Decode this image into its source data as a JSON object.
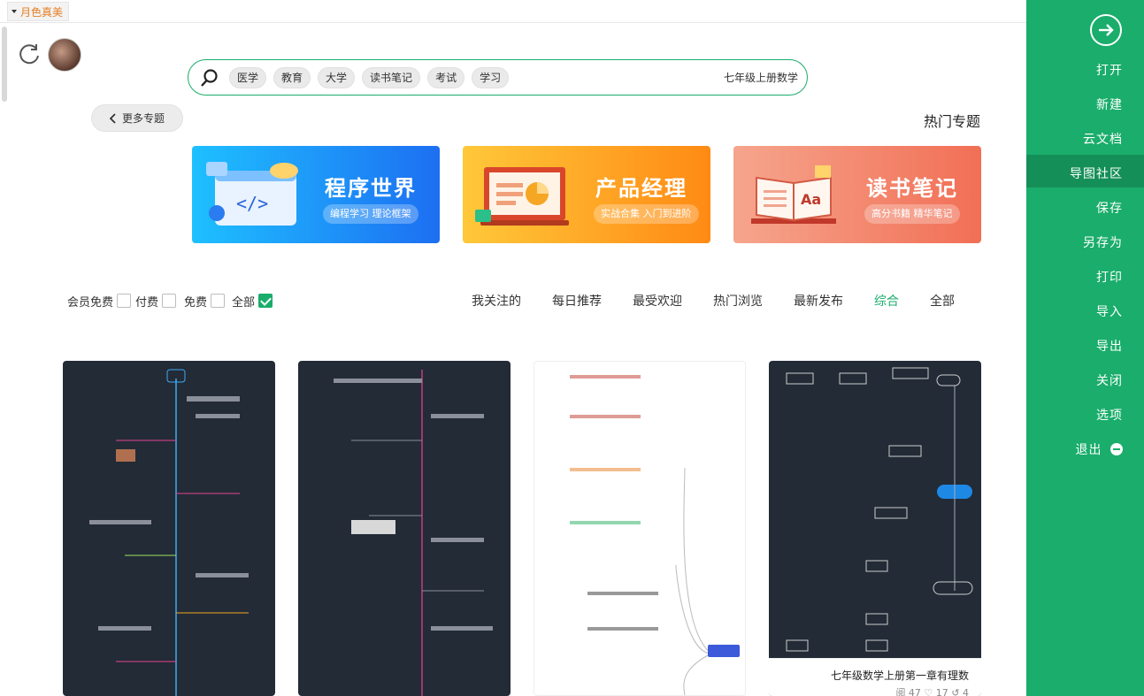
{
  "theme": {
    "label": "月色真美"
  },
  "search": {
    "placeholder": "七年级上册数学",
    "chips": [
      "学习",
      "考试",
      "读书笔记",
      "大学",
      "教育",
      "医学"
    ]
  },
  "section": {
    "title": "热门专题",
    "more_label": "更多专题"
  },
  "banners": [
    {
      "title": "读书笔记",
      "subtitle": "高分书籍 精华笔记"
    },
    {
      "title": "产品经理",
      "subtitle": "实战合集 入门到进阶"
    },
    {
      "title": "程序世界",
      "subtitle": "编程学习 理论框架"
    }
  ],
  "tabs": [
    "全部",
    "综合",
    "最新发布",
    "热门浏览",
    "最受欢迎",
    "每日推荐",
    "我关注的"
  ],
  "active_tab": "综合",
  "filters": [
    "全部",
    "免费",
    "付费",
    "会员免费"
  ],
  "cards": [
    {
      "caption": "七年级数学上册第一章有理数",
      "meta": "阅 47  ♡ 17  ↺ 4"
    },
    {
      "caption": "",
      "meta": ""
    },
    {
      "caption": "",
      "meta": ""
    },
    {
      "caption": "",
      "meta": ""
    }
  ],
  "sidebar": {
    "items": [
      "打开",
      "新建",
      "云文档",
      "导图社区",
      "保存",
      "另存为",
      "打印",
      "导入",
      "导出",
      "关闭",
      "选项",
      "退出"
    ],
    "active": "导图社区"
  },
  "colors": {
    "accent": "#1aad6b",
    "sidebar": "#1aad6b",
    "dark_card": "#222b36"
  }
}
